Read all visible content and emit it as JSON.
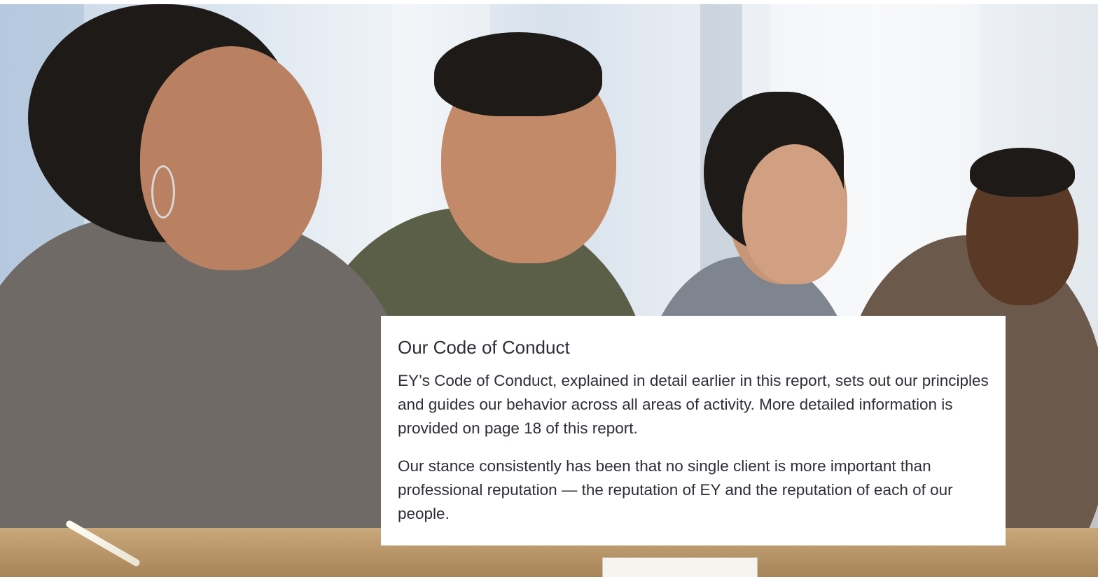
{
  "card": {
    "title": "Our Code of Conduct",
    "paragraphs": [
      "EY’s Code of Conduct, explained in detail earlier in this report, sets out our principles and guides our behavior across all areas of activity. More detailed information is provided on page 18 of this report.",
      "Our stance consistently has been that no single client is more important than professional reputation — the reputation of EY and the reputation of each of our people."
    ]
  },
  "photo": {
    "subject": "business-meeting-photo"
  }
}
